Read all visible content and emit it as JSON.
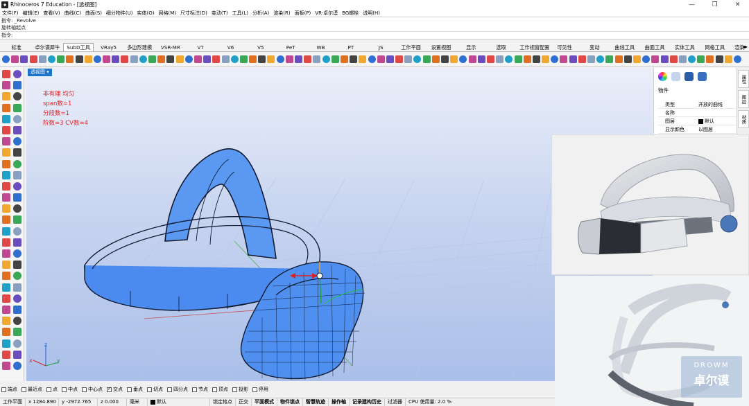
{
  "window": {
    "title": "Rhinoceros 7 Education - [透视图]",
    "controls": [
      "—",
      "❐",
      "✕"
    ]
  },
  "menu": [
    "文件(F)",
    "编辑(E)",
    "查看(V)",
    "曲线(C)",
    "曲面(S)",
    "细分物件(U)",
    "实体(O)",
    "网格(M)",
    "尺寸标注(D)",
    "变动(T)",
    "工具(L)",
    "分析(A)",
    "渲染(R)",
    "面板(P)",
    "VR-卓尔谟",
    "BG螺栓",
    "说明(H)"
  ],
  "command": {
    "history1": "指令: _Revolve",
    "history2": "旋转轴起点",
    "prompt": "指令:"
  },
  "tabs": [
    "标准",
    "卓尔谟犀牛",
    "SubD工具",
    "VRay5",
    "多边形建模",
    "VSR-MR",
    "V7",
    "V6",
    "V5",
    "PeT",
    "WB",
    "PT",
    "JS",
    "工作平面",
    "设置视图",
    "显示",
    "选取",
    "工作视窗配置",
    "可见性",
    "变动",
    "曲线工具",
    "曲面工具",
    "实体工具",
    "网格工具",
    "渲染"
  ],
  "active_tab": "SubD工具",
  "viewport": {
    "label": "透视图 ▾",
    "info": [
      "非有理 均匀",
      "span数=1",
      "分段数=1",
      "阶数=3   CV数=4"
    ],
    "axis_z": "z",
    "axis_x": "x",
    "axis_y": "y"
  },
  "properties": {
    "title": "物件",
    "rows": [
      {
        "k": "类型",
        "v": "开放的曲线"
      },
      {
        "k": "名称",
        "v": ""
      },
      {
        "k": "图层",
        "v": "默认"
      },
      {
        "k": "显示颜色",
        "v": "以图层"
      }
    ],
    "side_tabs": [
      "属性",
      "图层",
      "材质"
    ]
  },
  "watermark": {
    "en": "DROWM",
    "cn": "卓尔谟"
  },
  "osnaps": [
    {
      "label": "端点",
      "on": false
    },
    {
      "label": "最近点",
      "on": false
    },
    {
      "label": "点",
      "on": false
    },
    {
      "label": "中点",
      "on": false
    },
    {
      "label": "中心点",
      "on": false
    },
    {
      "label": "交点",
      "on": true
    },
    {
      "label": "垂点",
      "on": false
    },
    {
      "label": "切点",
      "on": false
    },
    {
      "label": "四分点",
      "on": false
    },
    {
      "label": "节点",
      "on": false
    },
    {
      "label": "顶点",
      "on": false
    },
    {
      "label": "投影",
      "on": false
    },
    {
      "label": "停用",
      "on": false
    }
  ],
  "status": {
    "cplane": "工作平面",
    "x": "x 1284.890",
    "y": "y -2972.765",
    "z": "z 0.000",
    "unit": "毫米",
    "layer": "默认",
    "grid_snap": "锁定格点",
    "ortho": "正交",
    "planar": "平面模式",
    "osnap": "物件锁点",
    "smarttrack": "智慧轨迹",
    "gumball": "操作轴",
    "history": "记录建构历史",
    "filter": "过滤器",
    "cpu": "CPU 使用量: 2.0 %"
  },
  "colors": {
    "accent": "#1e73c8",
    "info_text": "#e82020",
    "model_blue": "#4f8ff0"
  }
}
